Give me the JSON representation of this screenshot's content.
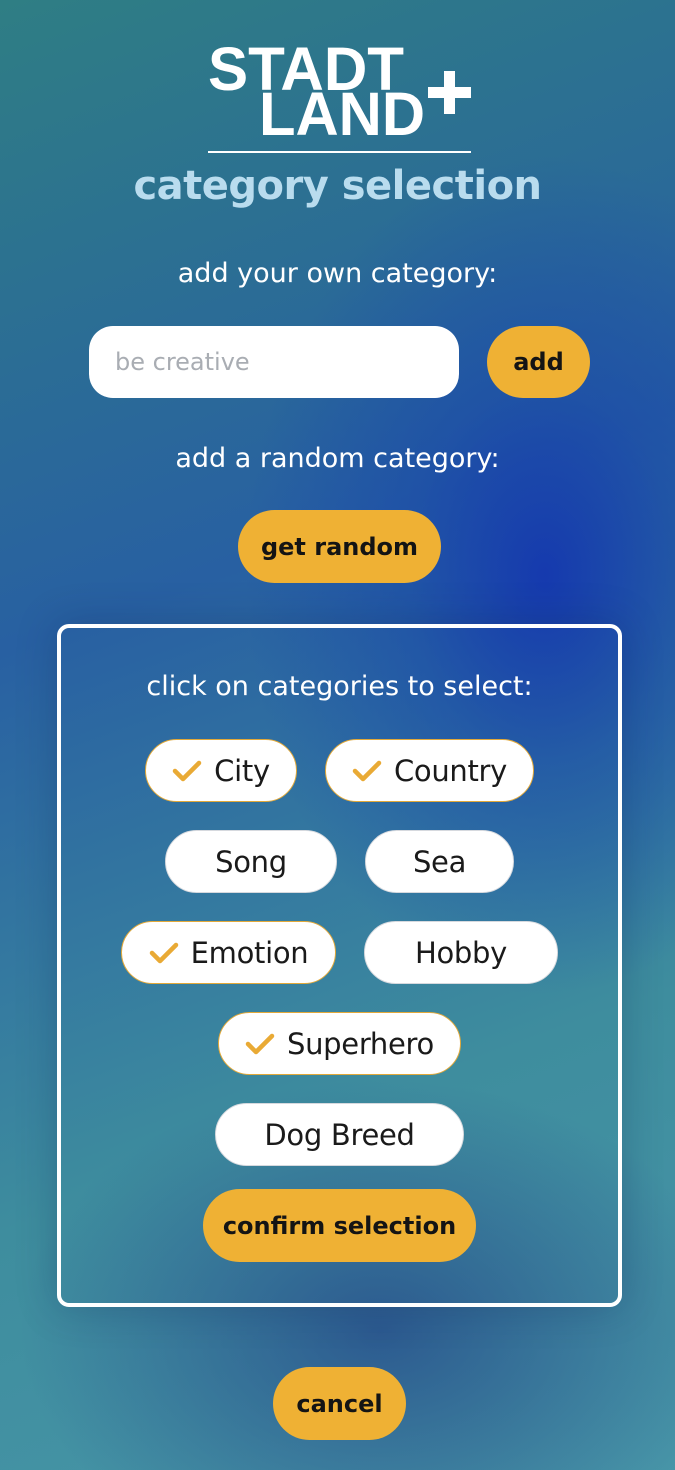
{
  "logo": {
    "line1": "STADT",
    "line2": "LAND",
    "plus": "+"
  },
  "page": {
    "title": "category selection"
  },
  "own_category": {
    "label": "add your own category:",
    "input_placeholder": "be creative",
    "input_value": "",
    "add_button": "add"
  },
  "random_category": {
    "label": "add a random category:",
    "button": "get random"
  },
  "selection": {
    "label": "click on categories to select:",
    "categories": [
      {
        "label": "City",
        "selected": true
      },
      {
        "label": "Country",
        "selected": true
      },
      {
        "label": "Song",
        "selected": false
      },
      {
        "label": "Sea",
        "selected": false
      },
      {
        "label": "Emotion",
        "selected": true
      },
      {
        "label": "Hobby",
        "selected": false
      },
      {
        "label": "Superhero",
        "selected": true
      },
      {
        "label": "Dog Breed",
        "selected": false
      }
    ],
    "confirm_button": "confirm selection"
  },
  "cancel_button": "cancel",
  "colors": {
    "accent": "#efb134",
    "title": "#b9dcee",
    "check": "#e9aa35"
  },
  "icons": {
    "selected": "checkmark-icon"
  }
}
